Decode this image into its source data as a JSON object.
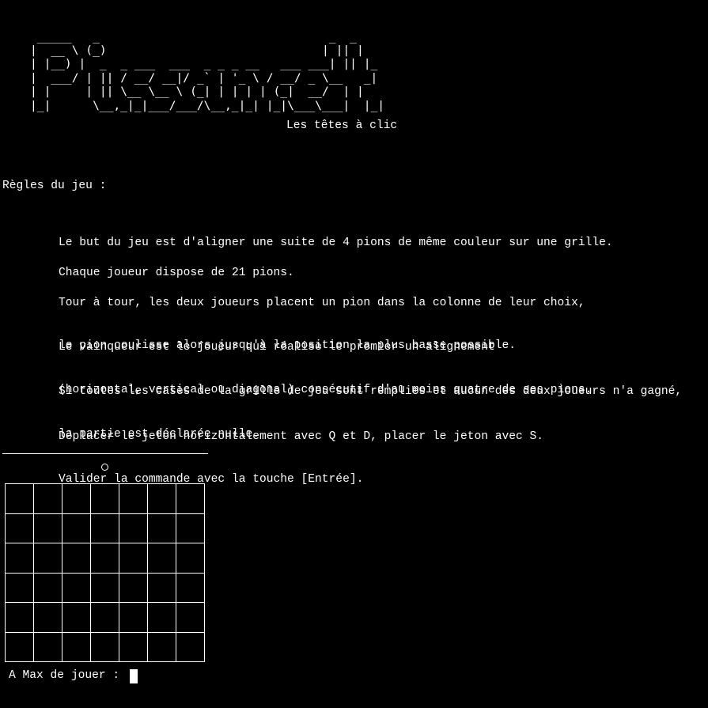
{
  "banner": {
    "ascii_art": " _____   _                                 _  _\n|  __ \\ (_)                               | || |\n| |__) |  _  _ ___  ___  _ _ _ __   ___ ___| || |_\n|  ___/ | || / __/ __|/ _` | '_ \\ / __/ _ \\__   _|\n| |     | || \\__ \\__ \\ (_| | | | | (_|  __/  | |\n|_|      \\__,_|_|___/___/\\__,_|_| |_|\\___\\___|  |_|",
    "subtitle": "Les têtes à clic"
  },
  "rules": {
    "heading": "Règles du jeu :",
    "paragraphs": [
      [
        "Le but du jeu est d'aligner une suite de 4 pions de même couleur sur une grille."
      ],
      [
        "Chaque joueur dispose de 21 pions."
      ],
      [
        "Tour à tour, les deux joueurs placent un pion dans la colonne de leur choix,",
        "le pion coulisse alors jusqu'à la position la plus basse possible."
      ],
      [
        "Le vainqueur est le joueur qui réalise le premier un alignement",
        "(horizontal, vertical ou diagonal) consécutif d'au moins quatre de ses pions."
      ],
      [
        "Si toutes les cases de la grille de jeu sont remplies et aucun des deux joueurs n'a gagné,",
        "la partie est déclarée nulle."
      ],
      [
        "Déplacer le jeton horizontalement avec Q et D, placer le jeton avec S.",
        "Valider la commande avec la touche [Entrée]."
      ]
    ]
  },
  "board": {
    "columns": 7,
    "rows": 6,
    "token_column": 4,
    "token_glyph": "○"
  },
  "prompt": {
    "text": "A Max de jouer :"
  },
  "colors": {
    "background": "#000000",
    "foreground": "#ffffff"
  }
}
